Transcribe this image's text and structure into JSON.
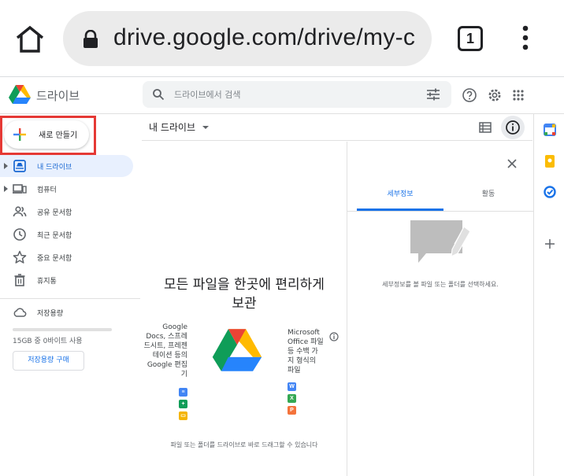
{
  "browser": {
    "url": "drive.google.com/drive/my-c",
    "tab_count": "1",
    "icons": [
      "home-icon",
      "lock-icon",
      "tabs-icon",
      "more-vert-icon"
    ]
  },
  "header": {
    "app_name": "드라이브",
    "search_placeholder": "드라이브에서 검색",
    "icons": [
      "search-icon",
      "tune-icon",
      "help-icon",
      "settings-icon",
      "apps-icon"
    ]
  },
  "sidebar": {
    "new_label": "새로 만들기",
    "items": [
      {
        "label": "내 드라이브",
        "icon": "my-drive-icon",
        "active": true
      },
      {
        "label": "컴퓨터",
        "icon": "computer-icon",
        "active": false
      },
      {
        "label": "공유 문서함",
        "icon": "shared-icon",
        "active": false
      },
      {
        "label": "최근 문서함",
        "icon": "clock-icon",
        "active": false
      },
      {
        "label": "중요 문서함",
        "icon": "star-icon",
        "active": false
      },
      {
        "label": "휴지통",
        "icon": "trash-icon",
        "active": false
      }
    ],
    "storage_label": "저장용량",
    "storage_text": "15GB 중 0바이트 사용",
    "storage_used_fraction": 0,
    "buy_storage": "저장용량 구매"
  },
  "main": {
    "title": "내 드라이브",
    "empty_title_line1": "모든 파일을 한곳에 편리하게",
    "empty_title_line2": "보관",
    "left_text": "Google Docs, 스프레드시트, 프레젠테이션 등의 Google 편집기",
    "right_text": "Microsoft Office 파일 등 수백 가지 형식의 파일",
    "left_app_icons": [
      "docs-icon",
      "sheets-icon",
      "slides-icon"
    ],
    "right_app_icons": [
      {
        "name": "word-icon",
        "letter": "W",
        "color": "#4285f4"
      },
      {
        "name": "excel-icon",
        "letter": "X",
        "color": "#34a853"
      },
      {
        "name": "powerpoint-icon",
        "letter": "P",
        "color": "#f4733b"
      }
    ],
    "hint": "파일 또는 폴더를 드라이브로 바로 드래그할 수 있습니다"
  },
  "details": {
    "tabs": [
      {
        "label": "세부정보",
        "active": true
      },
      {
        "label": "활동",
        "active": false
      }
    ],
    "hint": "세부정보를 볼 파일 또는 폴더를 선택하세요."
  },
  "right_rail": {
    "icons": [
      "calendar-icon",
      "keep-icon",
      "tasks-icon",
      "add-icon"
    ]
  },
  "colors": {
    "accent": "#1a73e8",
    "active_bg": "#e8f0fe",
    "highlight": "#e53935"
  }
}
